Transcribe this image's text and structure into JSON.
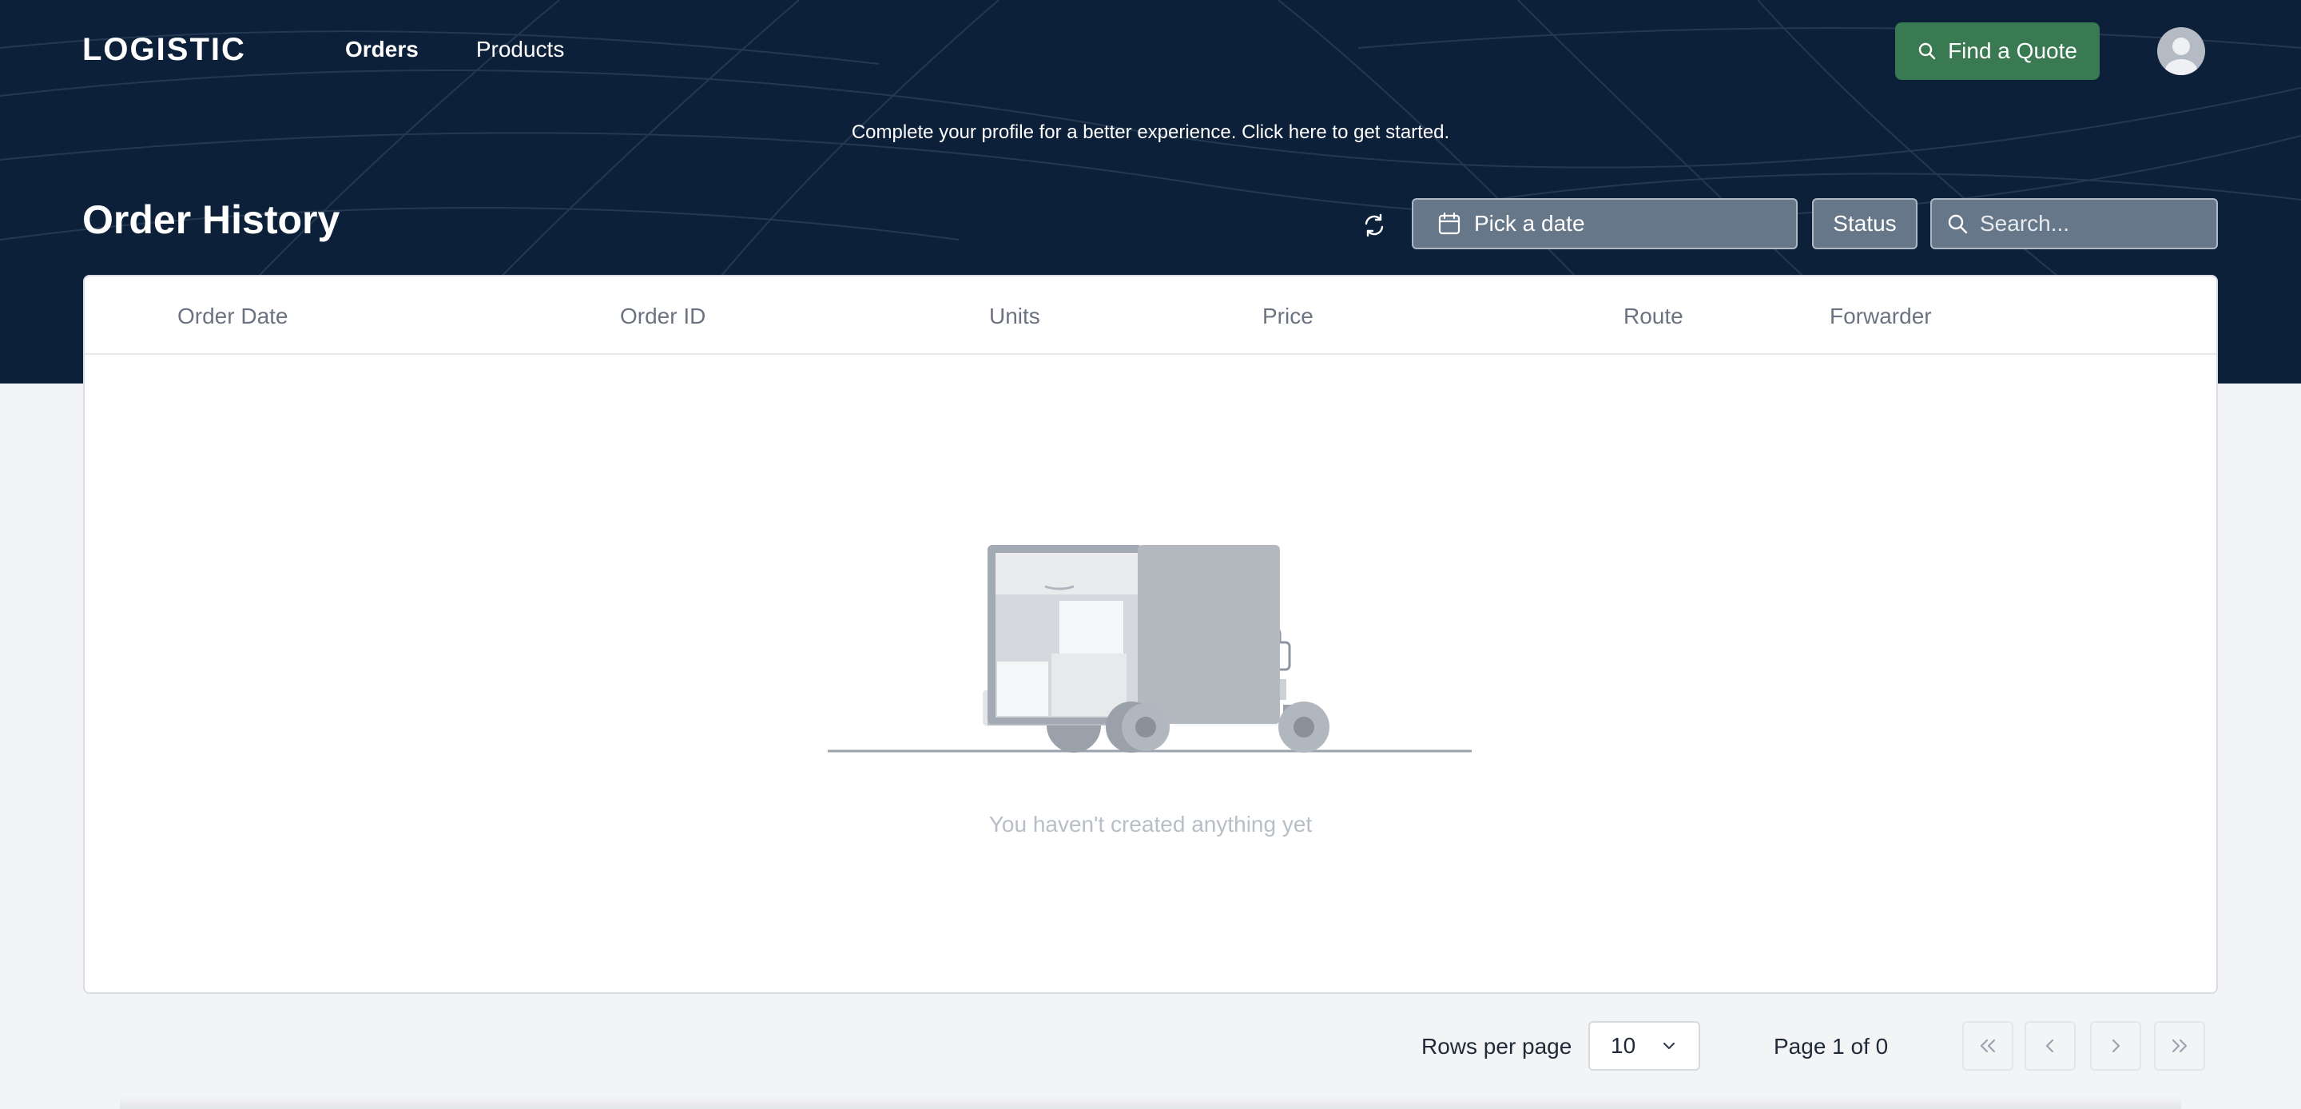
{
  "brand": {
    "logo_text": "LOGISTIC"
  },
  "nav": {
    "items": [
      {
        "label": "Orders",
        "active": true
      },
      {
        "label": "Products",
        "active": false
      }
    ]
  },
  "header": {
    "quote_button": "Find a Quote"
  },
  "banner": {
    "text": "Complete your profile for a better experience. Click here to get started."
  },
  "page": {
    "title": "Order History"
  },
  "filters": {
    "date_placeholder": "Pick a date",
    "status_label": "Status",
    "search_placeholder": "Search..."
  },
  "table": {
    "columns": [
      "Order Date",
      "Order ID",
      "Units",
      "Price",
      "Route",
      "Forwarder"
    ],
    "rows": [],
    "empty_message": "You haven't created anything yet"
  },
  "pagination": {
    "rows_per_page_label": "Rows per page",
    "rows_per_page_value": "10",
    "page_info": "Page 1 of 0"
  },
  "colors": {
    "hero_bg": "#0c2039",
    "accent_green": "#3a7a52",
    "page_bg": "#f3f4f6"
  }
}
